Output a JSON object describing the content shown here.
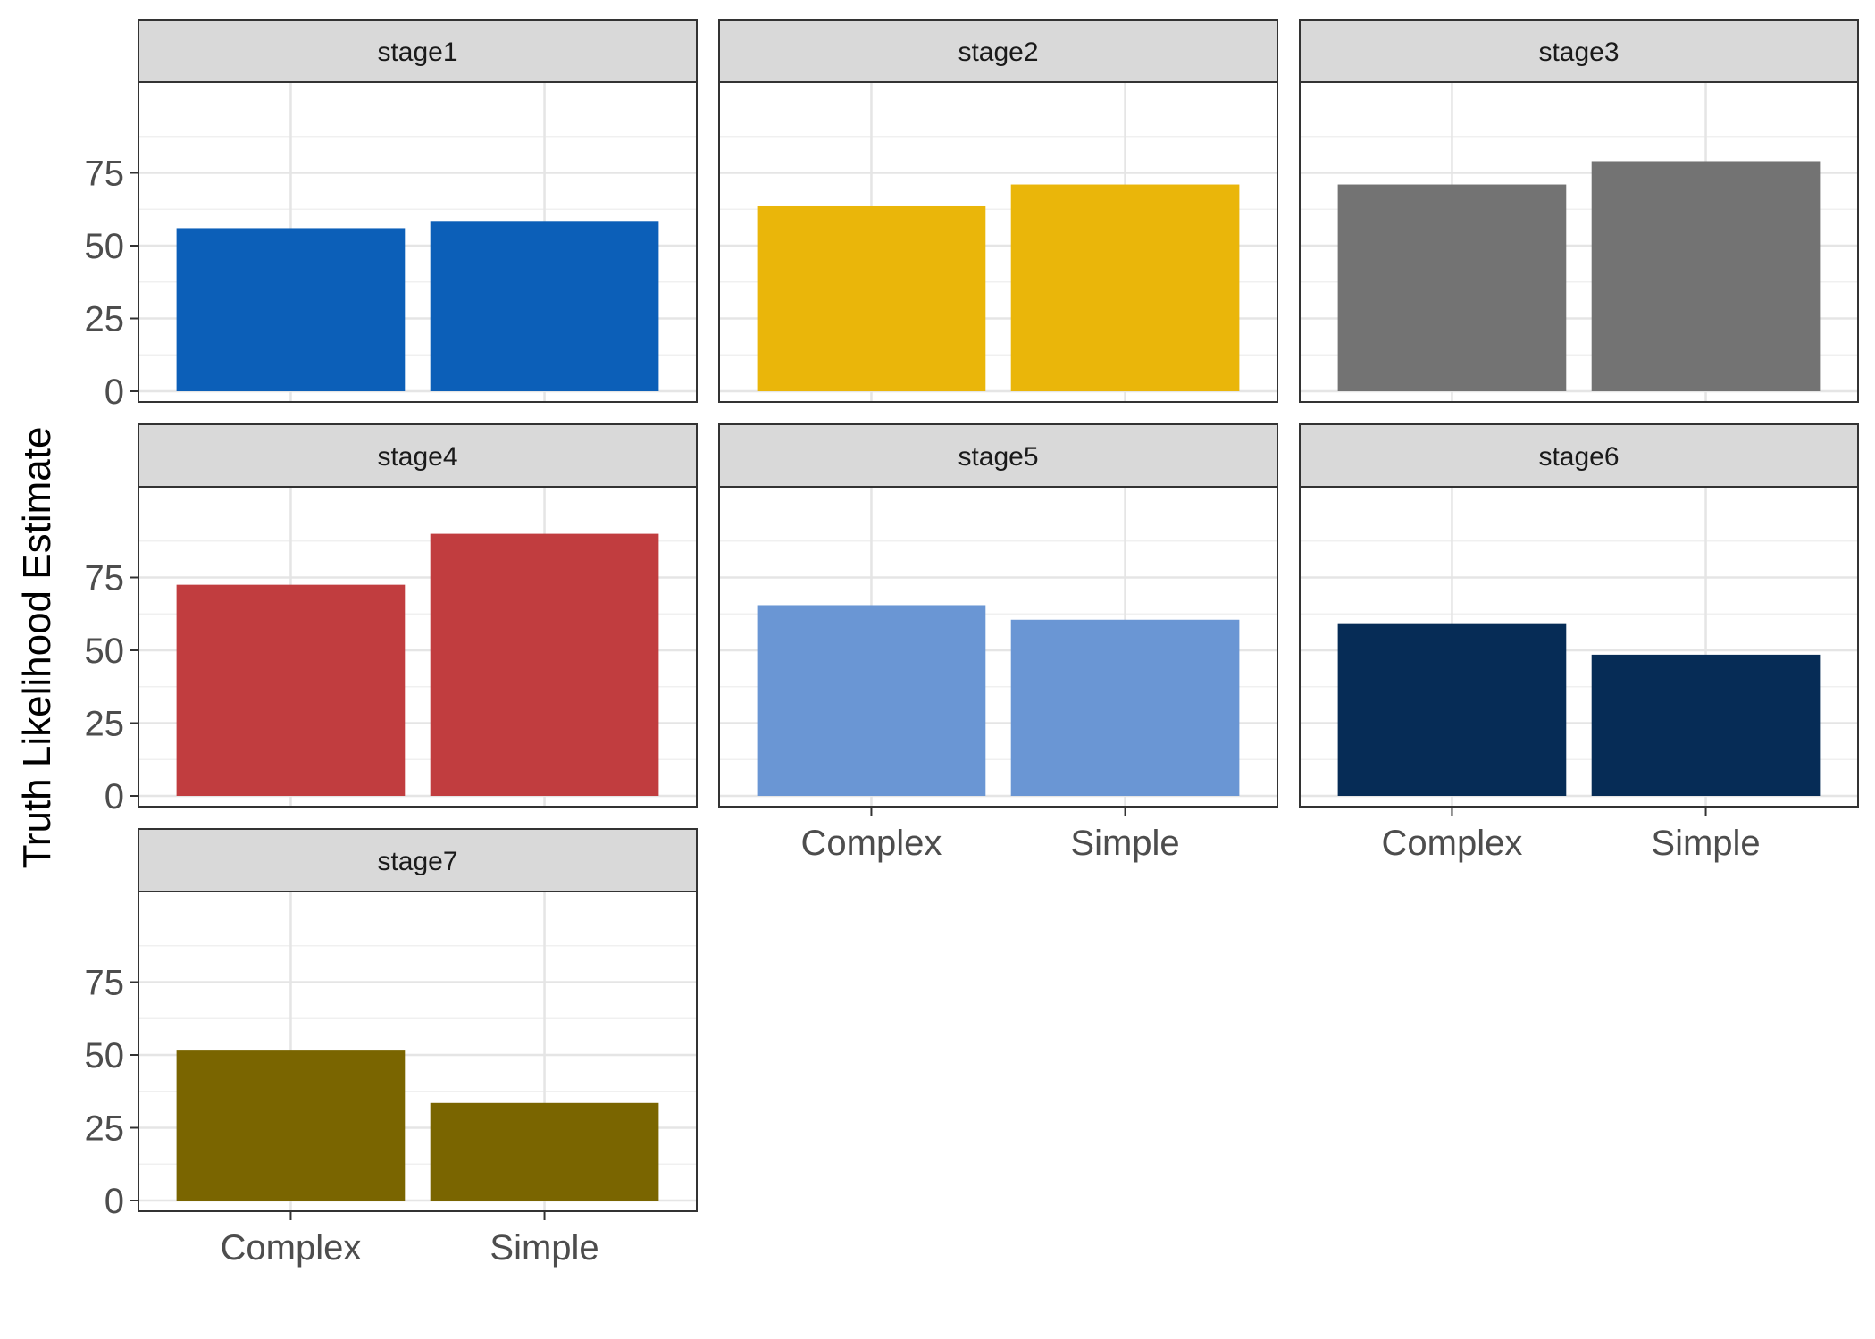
{
  "chart_data": {
    "type": "bar",
    "layout": "facet-wrap",
    "ylabel": "Truth Likelihood Estimate",
    "xlabel": "",
    "ylim": [
      0,
      100
    ],
    "y_ticks": [
      0,
      25,
      50,
      75
    ],
    "categories": [
      "Complex",
      "Simple"
    ],
    "panels": [
      {
        "label": "stage1",
        "color": "#0C5FB8",
        "values": [
          56,
          58.5
        ]
      },
      {
        "label": "stage2",
        "color": "#EAB60A",
        "values": [
          63.5,
          71
        ]
      },
      {
        "label": "stage3",
        "color": "#737373",
        "values": [
          71,
          79
        ]
      },
      {
        "label": "stage4",
        "color": "#C13D3F",
        "values": [
          72.5,
          90
        ]
      },
      {
        "label": "stage5",
        "color": "#6A96D4",
        "values": [
          65.5,
          60.5
        ]
      },
      {
        "label": "stage6",
        "color": "#062C56",
        "values": [
          59,
          48.5
        ]
      },
      {
        "label": "stage7",
        "color": "#7A6500",
        "values": [
          51.5,
          33.5
        ]
      }
    ]
  }
}
